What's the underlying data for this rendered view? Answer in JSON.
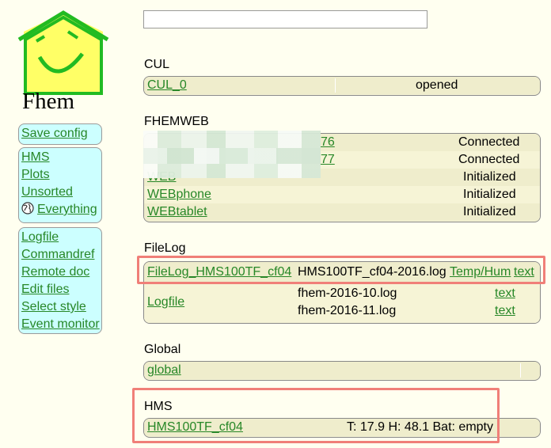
{
  "logo": {
    "text": "Fhem"
  },
  "search": {
    "value": ""
  },
  "menu": {
    "save_config": "Save config",
    "rooms": [
      "HMS",
      "Plots",
      "Unsorted"
    ],
    "everything": "Everything",
    "links": [
      "Logfile",
      "Commandref",
      "Remote doc",
      "Edit files",
      "Select style",
      "Event monitor"
    ]
  },
  "groups": {
    "cul": {
      "title": "CUL",
      "rows": [
        {
          "name": "CUL_0",
          "state": "opened"
        }
      ]
    },
    "fhemweb": {
      "title": "FHEMWEB",
      "rows": [
        {
          "name": "76",
          "state": "Connected"
        },
        {
          "name": "77",
          "state": "Connected"
        },
        {
          "name": "WEB",
          "state": "Initialized"
        },
        {
          "name": "WEBphone",
          "state": "Initialized"
        },
        {
          "name": "WEBtablet",
          "state": "Initialized"
        }
      ]
    },
    "filelog": {
      "title": "FileLog",
      "row1": {
        "name": "FileLog_HMS100TF_cf04",
        "file": "HMS100TF_cf04-2016.log",
        "link1": "Temp/Hum",
        "link2": "text"
      },
      "row2": {
        "name": "Logfile",
        "files": [
          "fhem-2016-10.log",
          "fhem-2016-11.log"
        ],
        "links": [
          "text",
          "text"
        ]
      }
    },
    "global": {
      "title": "Global",
      "rows": [
        {
          "name": "global"
        }
      ]
    },
    "hms": {
      "title": "HMS",
      "rows": [
        {
          "name": "HMS100TF_cf04",
          "state": "T: 17.9 H: 48.1 Bat: empty"
        }
      ]
    }
  },
  "colors": {
    "link": "#278727",
    "menu_bg": "#ccffff",
    "block_bg": "#f6f4d6",
    "highlight": "#f07f78"
  }
}
